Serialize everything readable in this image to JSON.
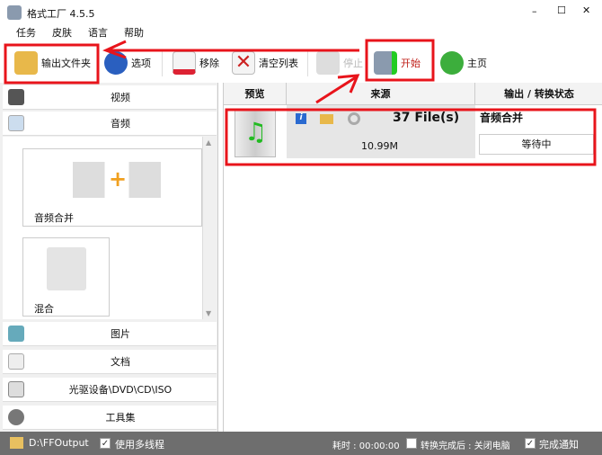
{
  "window": {
    "title": "格式工厂 4.5.5",
    "minimize": "–",
    "maximize": "☐",
    "close": "✕"
  },
  "menu": [
    "任务",
    "皮肤",
    "语言",
    "帮助"
  ],
  "toolbar": {
    "output_folder": "输出文件夹",
    "options": "选项",
    "remove": "移除",
    "clear_list": "清空列表",
    "stop": "停止",
    "start": "开始",
    "home": "主页"
  },
  "categories": {
    "video": "视频",
    "audio": "音频",
    "image": "图片",
    "document": "文档",
    "rom": "光驱设备\\DVD\\CD\\ISO",
    "tools": "工具集"
  },
  "audio_items": [
    "音频合并",
    "混合"
  ],
  "table": {
    "headers": [
      "预览",
      "来源",
      "输出 / 转换状态"
    ],
    "row": {
      "files": "37 File(s)",
      "size": "10.99M",
      "task": "音频合并",
      "status": "等待中"
    }
  },
  "status": {
    "path": "D:\\FFOutput",
    "multithread": "使用多线程",
    "elapsed": "耗时 : 00:00:00",
    "after": "转换完成后 : 关闭电脑",
    "notify": "完成通知",
    "check": "✓"
  },
  "colors": {
    "annotation": "#e8141b"
  }
}
